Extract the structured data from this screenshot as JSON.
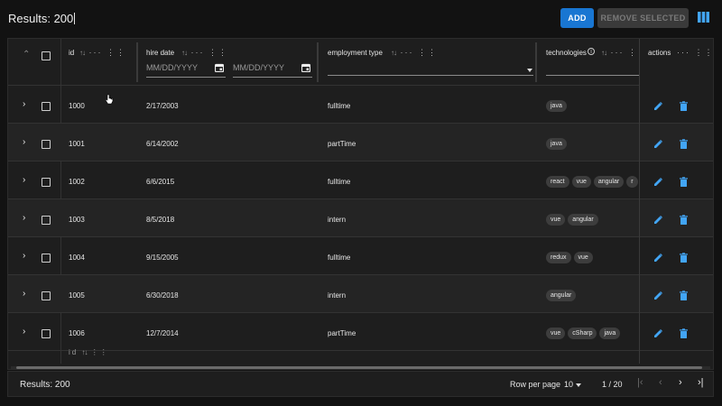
{
  "toolbar": {
    "results_label": "Results: 200",
    "add_label": "ADD",
    "remove_selected_label": "REMOVE SELECTED",
    "columns_icon": "view-column-icon",
    "accent_color": "#1976d2"
  },
  "grid": {
    "columns": [
      {
        "key": "id",
        "label": "id"
      },
      {
        "key": "hire_date",
        "label": "hire date",
        "from_placeholder": "MM/DD/YYYY",
        "to_placeholder": "MM/DD/YYYY"
      },
      {
        "key": "employment_type",
        "label": "employment type"
      },
      {
        "key": "technologies",
        "label": "technologies"
      },
      {
        "key": "actions",
        "label": "actions"
      }
    ],
    "rows": [
      {
        "id": "1000",
        "hire_date": "2/17/2003",
        "employment_type": "fulltime",
        "technologies": [
          "java"
        ]
      },
      {
        "id": "1001",
        "hire_date": "6/14/2002",
        "employment_type": "partTime",
        "technologies": [
          "java"
        ]
      },
      {
        "id": "1002",
        "hire_date": "6/6/2015",
        "employment_type": "fulltime",
        "technologies": [
          "react",
          "vue",
          "angular",
          "r"
        ]
      },
      {
        "id": "1003",
        "hire_date": "8/5/2018",
        "employment_type": "intern",
        "technologies": [
          "vue",
          "angular"
        ]
      },
      {
        "id": "1004",
        "hire_date": "9/15/2005",
        "employment_type": "fulltime",
        "technologies": [
          "redux",
          "vue"
        ]
      },
      {
        "id": "1005",
        "hire_date": "6/30/2018",
        "employment_type": "intern",
        "technologies": [
          "angular"
        ]
      },
      {
        "id": "1006",
        "hire_date": "12/7/2014",
        "employment_type": "partTime",
        "technologies": [
          "vue",
          "cSharp",
          "java"
        ]
      }
    ],
    "footer_row": {
      "label": "id"
    }
  },
  "pagination": {
    "results_label": "Results: 200",
    "rows_per_page_label": "Row per page",
    "rows_per_page_value": "10",
    "page_info": "1 / 20"
  }
}
